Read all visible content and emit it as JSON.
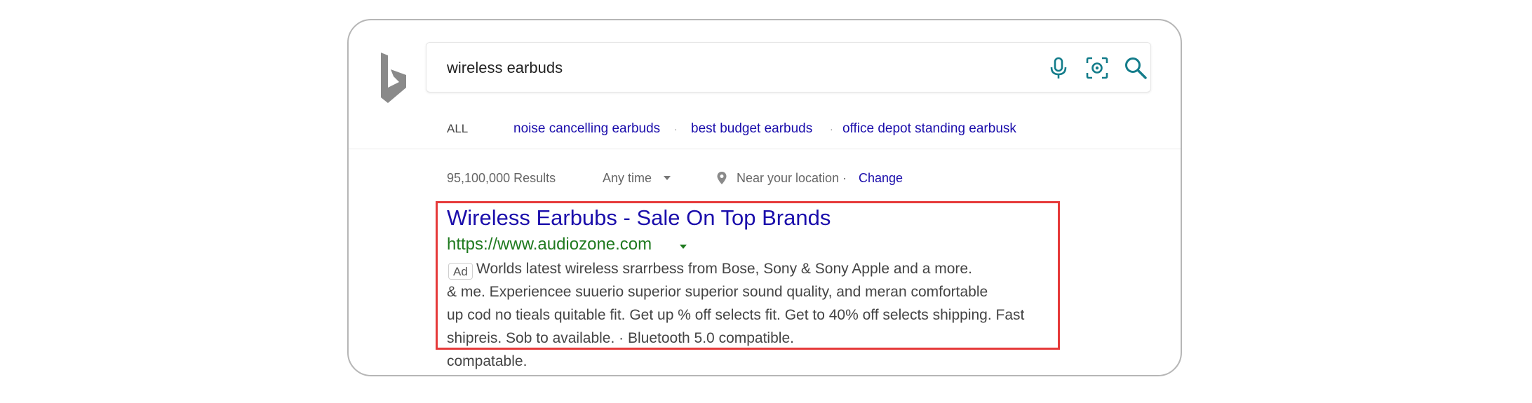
{
  "search": {
    "query": "wireless earbuds"
  },
  "filters": {
    "all_label": "ALL",
    "related": [
      "noise cancelling earbuds",
      "best budget earbuds",
      "office depot standing earbusk"
    ],
    "separator": "·"
  },
  "meta": {
    "results_count": "95,100,000 Results",
    "time_filter": "Any time",
    "location_text": "Near your location ·",
    "change_label": "Change"
  },
  "ad": {
    "title": "Wireless Earbubs - Sale On Top Brands",
    "url": "https://www.audiozone.com",
    "badge": "Ad",
    "description_lines": [
      "Worlds latest wireless srarrbess from Bose, Sony  & Sony Apple and a more.",
      "& me. Experiencee suuerio superior superior sound quality,  and meran comfortable",
      "up cod no tieals quitable fit. Get up % off selects fit.  Get to 40% off selects shipping.  Fast",
      "shipreis. Sob to available. · Bluetooth 5.0 compatible.",
      "compatable."
    ]
  },
  "colors": {
    "link_blue": "#1a0dab",
    "url_green": "#1f7a1f",
    "highlight_red": "#e63a3a",
    "icon_teal": "#137c8a"
  },
  "icons": {
    "logo": "bing-logo",
    "mic": "microphone-icon",
    "visual": "visual-search-icon",
    "search": "search-icon",
    "location": "location-pin-icon"
  }
}
